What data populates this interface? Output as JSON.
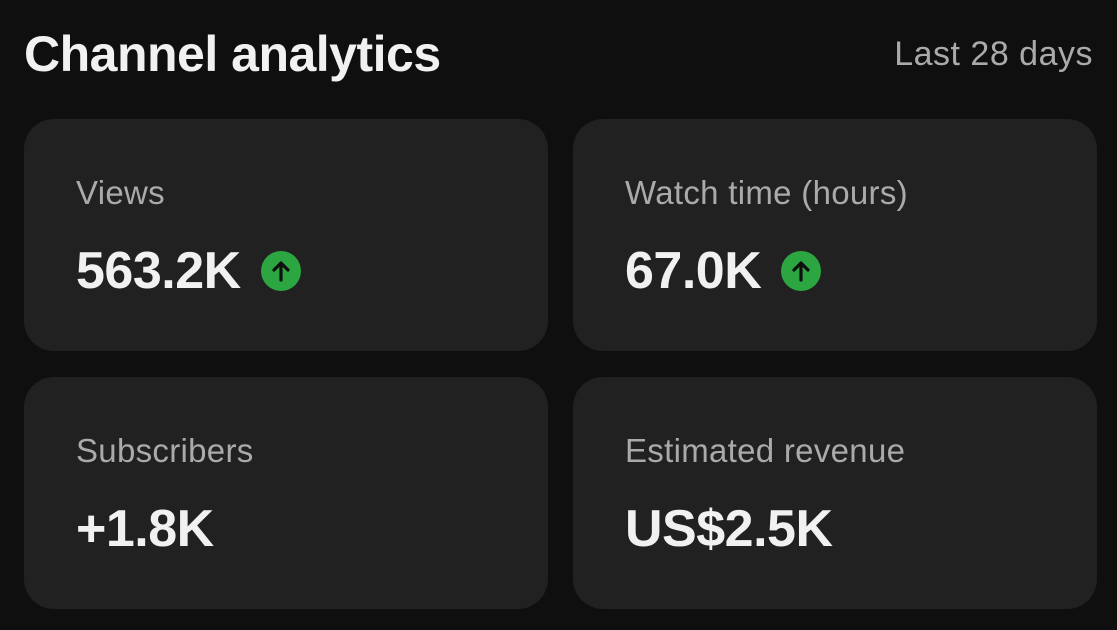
{
  "header": {
    "title": "Channel analytics",
    "period": "Last 28 days"
  },
  "colors": {
    "background": "#0f0f0f",
    "card": "#212121",
    "trend_up": "#2ba640"
  },
  "cards": [
    {
      "label": "Views",
      "value": "563.2K",
      "trend_icon": "arrow-up-icon"
    },
    {
      "label": "Watch time (hours)",
      "value": "67.0K",
      "trend_icon": "arrow-up-icon"
    },
    {
      "label": "Subscribers",
      "value": "+1.8K"
    },
    {
      "label": "Estimated revenue",
      "value": "US$2.5K"
    }
  ]
}
